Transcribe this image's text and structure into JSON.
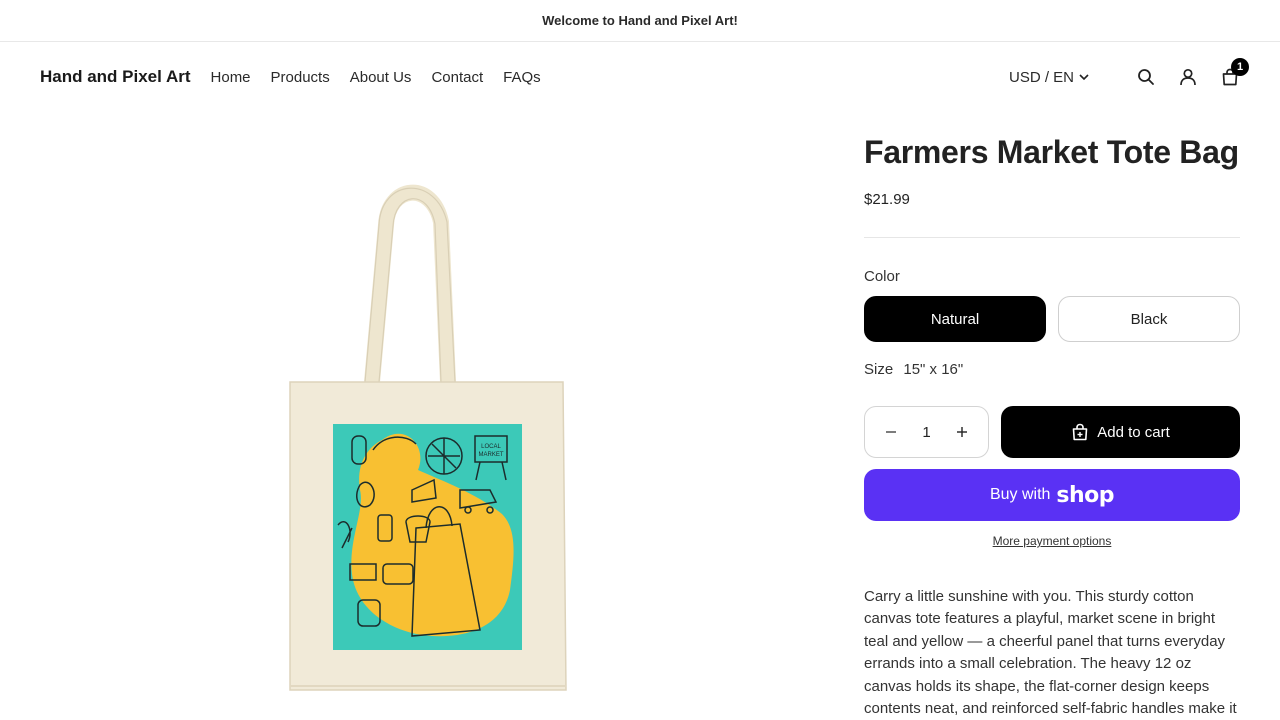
{
  "announcement": {
    "text": "Welcome to Hand and Pixel Art!"
  },
  "header": {
    "logo": "Hand and Pixel Art",
    "nav": [
      "Home",
      "Products",
      "About Us",
      "Contact",
      "FAQs"
    ],
    "currency": "USD / EN",
    "cart_count": "1",
    "icons": [
      "search-icon",
      "account-icon",
      "cart-icon"
    ]
  },
  "product": {
    "title": "Farmers Market Tote Bag",
    "price": "$21.99",
    "color_label": "Color",
    "colors": [
      "Natural",
      "Black"
    ],
    "selected_color": "Natural",
    "size_label": "Size",
    "size_value": "15\" x 16\"",
    "quantity": "1",
    "add_to_cart": "Add to cart",
    "buy_with": "Buy with",
    "shop_word": "shop",
    "more_payment": "More payment options",
    "description": "Carry a little sunshine with you. This sturdy cotton canvas tote features a playful, market scene in bright teal and yellow — a cheerful panel that turns everyday errands into a small celebration. The heavy 12 oz canvas holds its shape, the flat-corner design keeps contents neat, and reinforced self-fabric handles make it easy to"
  },
  "artwork": {
    "sign_text": "LOCAL MARKET"
  },
  "colors": {
    "accent": "#000000",
    "shop_pay": "#5a31f4",
    "panel_teal": "#3cc9b8",
    "panel_yellow": "#f8c032",
    "canvas": "#f1ead8"
  }
}
